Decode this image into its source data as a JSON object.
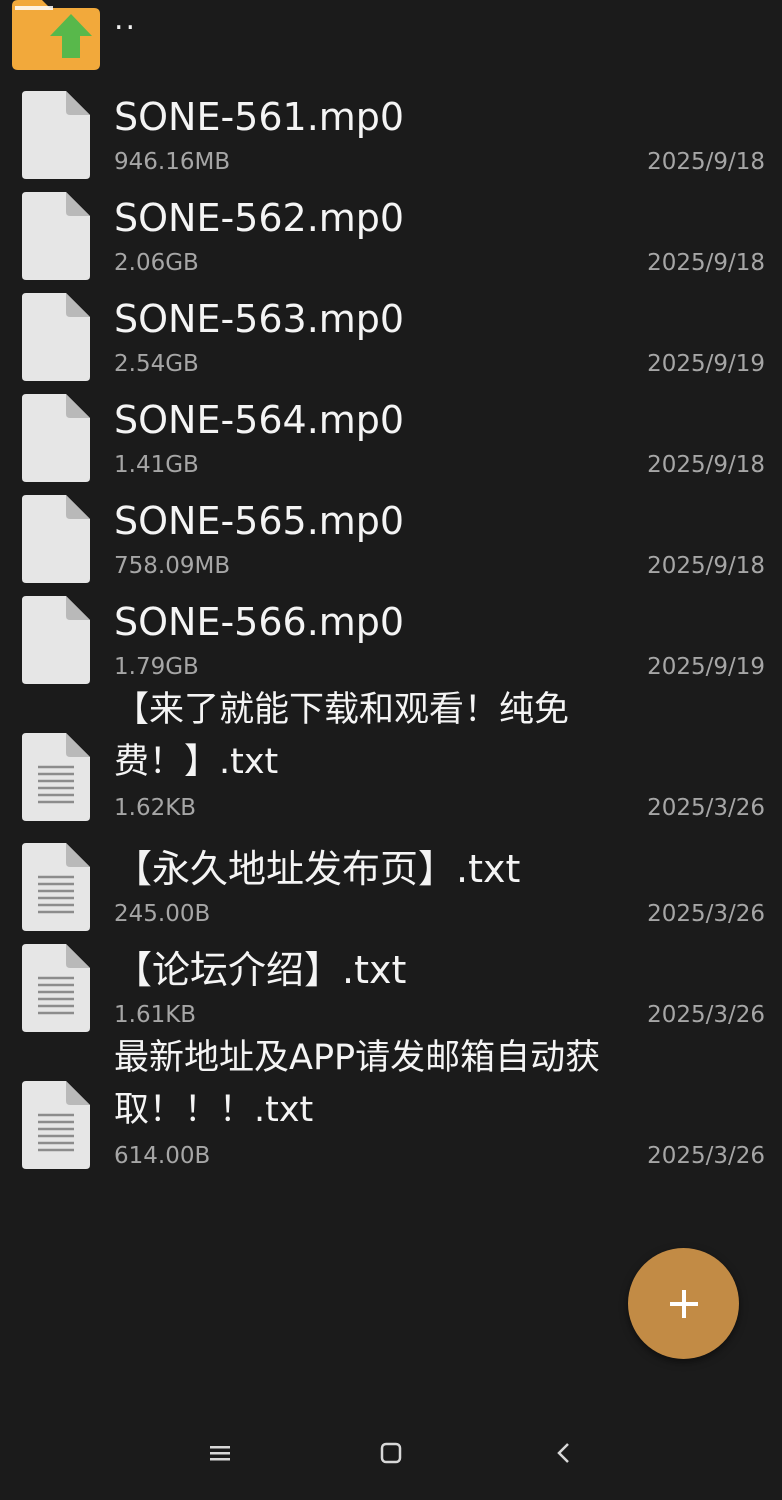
{
  "parent_dir": {
    "label": "..",
    "icon": "folder-up-icon"
  },
  "files": [
    {
      "name": "SONE-561.mp0",
      "size": "946.16MB",
      "date": "2025/9/18",
      "type": "generic"
    },
    {
      "name": "SONE-562.mp0",
      "size": "2.06GB",
      "date": "2025/9/18",
      "type": "generic"
    },
    {
      "name": "SONE-563.mp0",
      "size": "2.54GB",
      "date": "2025/9/19",
      "type": "generic"
    },
    {
      "name": "SONE-564.mp0",
      "size": "1.41GB",
      "date": "2025/9/18",
      "type": "generic"
    },
    {
      "name": "SONE-565.mp0",
      "size": "758.09MB",
      "date": "2025/9/18",
      "type": "generic"
    },
    {
      "name": "SONE-566.mp0",
      "size": "1.79GB",
      "date": "2025/9/19",
      "type": "generic"
    },
    {
      "name": "【来了就能下载和观看！纯免费！】.txt",
      "size": "1.62KB",
      "date": "2025/3/26",
      "type": "text"
    },
    {
      "name": "【永久地址发布页】.txt",
      "size": "245.00B",
      "date": "2025/3/26",
      "type": "text"
    },
    {
      "name": "【论坛介绍】.txt",
      "size": "1.61KB",
      "date": "2025/3/26",
      "type": "text"
    },
    {
      "name": "最新地址及APP请发邮箱自动获取！！！.txt",
      "size": "614.00B",
      "date": "2025/3/26",
      "type": "text"
    }
  ],
  "fab": {
    "icon": "plus-icon"
  },
  "navbar": {
    "icons": [
      "menu-icon",
      "home-square-icon",
      "back-chevron-icon"
    ]
  },
  "colors": {
    "background": "#1b1b1b",
    "text_primary": "#f4f4f4",
    "text_secondary": "#a6a6a6",
    "fab": "#c28b45",
    "folder": "#f2a93b",
    "arrow": "#58b84b",
    "file_icon": "#e6e6e6"
  }
}
